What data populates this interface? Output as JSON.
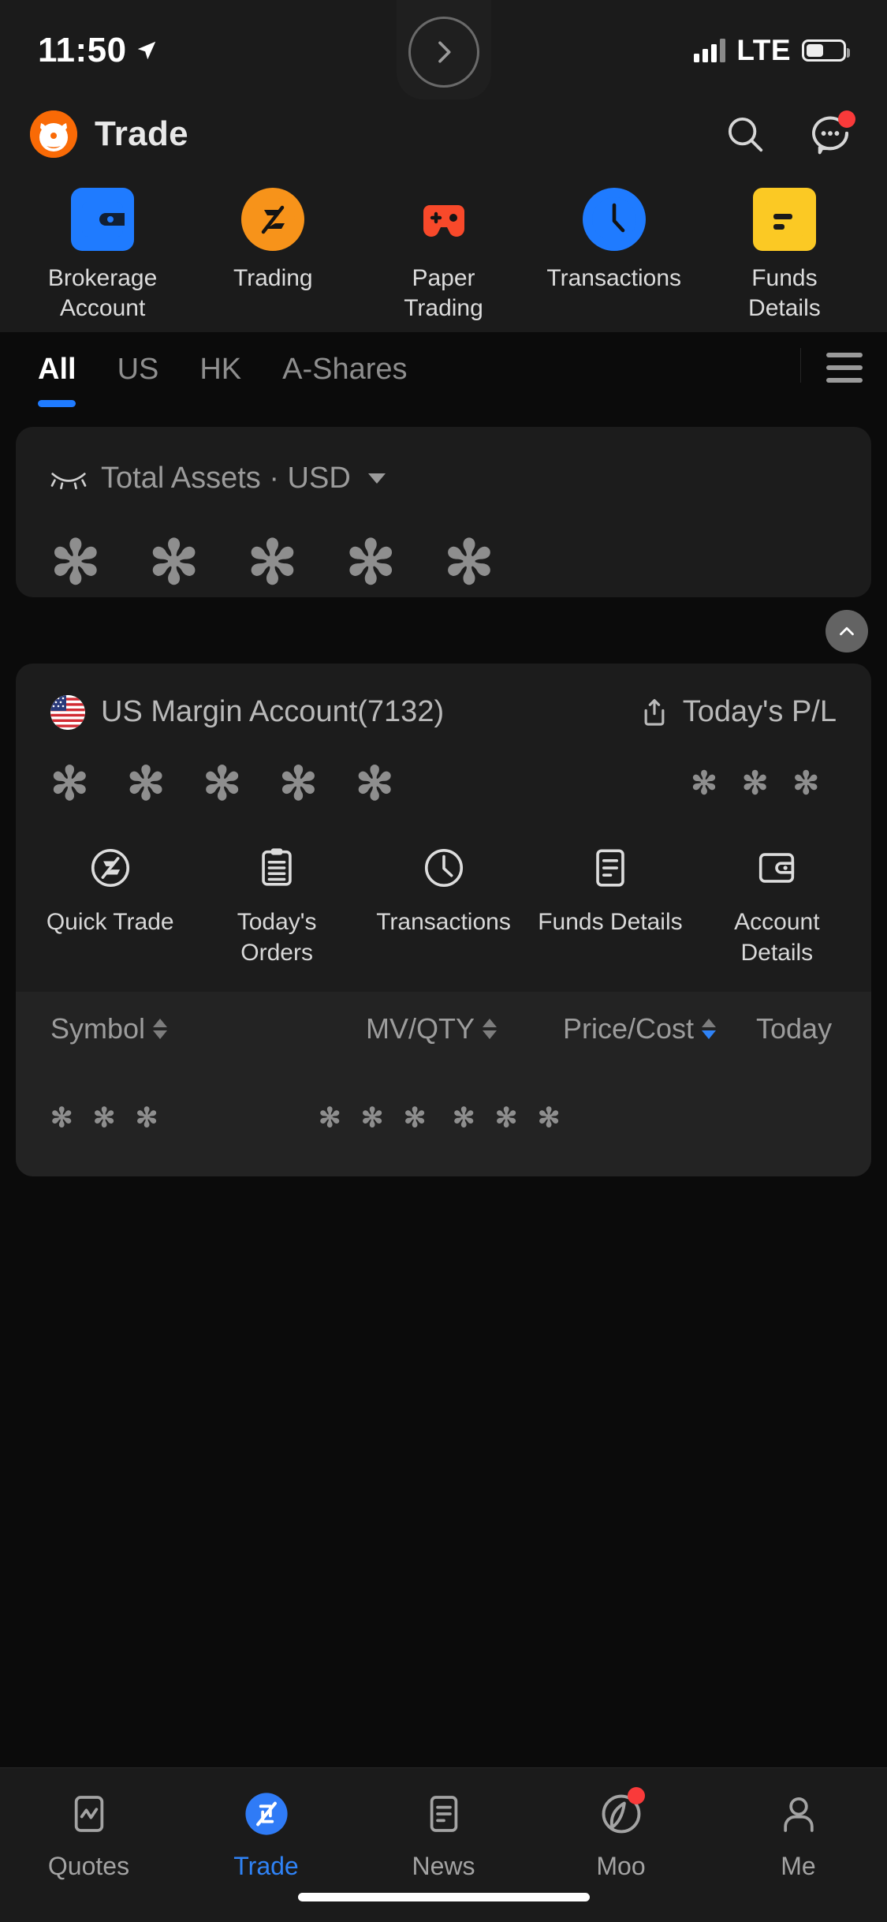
{
  "status_bar": {
    "time": "11:50",
    "location_icon": "location-arrow-icon",
    "carrier": "LTE",
    "signal_icon": "signal-bars-icon",
    "battery_icon": "battery-icon",
    "notch_button_icon": "chevron-right-circle-icon"
  },
  "header": {
    "logo_icon": "moomoo-bull-logo",
    "title": "Trade",
    "search_icon": "search-icon",
    "messages_icon": "message-dots-icon",
    "messages_has_badge": true
  },
  "quick_actions": [
    {
      "label": "Brokerage Account",
      "icon": "wallet-icon",
      "color": "#1f7bff"
    },
    {
      "label": "Trading",
      "icon": "trading-z-icon",
      "color": "#f7931a"
    },
    {
      "label": "Paper Trading",
      "icon": "gamepad-icon",
      "color": "#f8492a"
    },
    {
      "label": "Transactions",
      "icon": "clock-icon",
      "color": "#1f7bff"
    },
    {
      "label": "Funds Details",
      "icon": "document-icon",
      "color": "#fbc924"
    }
  ],
  "filter_tabs": {
    "items": [
      {
        "label": "All",
        "active": true
      },
      {
        "label": "US",
        "active": false
      },
      {
        "label": "HK",
        "active": false
      },
      {
        "label": "A-Shares",
        "active": false
      }
    ],
    "menu_icon": "hamburger-menu-icon",
    "active_color": "#1f7bff"
  },
  "total_assets": {
    "eye_icon": "eye-closed-icon",
    "label": "Total Assets · USD",
    "currency_caret_icon": "chevron-down-icon",
    "value_masked": "✻ ✻ ✻ ✻ ✻"
  },
  "collapse_button": {
    "icon": "chevron-up-icon"
  },
  "account": {
    "flag_icon": "us-flag-icon",
    "name": "US Margin Account(7132)",
    "pl_share_icon": "share-export-icon",
    "pl_label": "Today's P/L",
    "balance_masked": "✻ ✻ ✻ ✻ ✻",
    "pl_masked": "✻ ✻ ✻",
    "actions": [
      {
        "label": "Quick Trade",
        "icon": "quick-trade-icon"
      },
      {
        "label": "Today's Orders",
        "icon": "clipboard-orders-icon"
      },
      {
        "label": "Transactions",
        "icon": "clock-icon"
      },
      {
        "label": "Funds Details",
        "icon": "document-lines-icon"
      },
      {
        "label": "Account Details",
        "icon": "wallet-outline-icon"
      }
    ]
  },
  "positions_table": {
    "columns": [
      {
        "label": "Symbol",
        "sortable": true,
        "sort_state": "none"
      },
      {
        "label": "MV/QTY",
        "sortable": true,
        "sort_state": "none"
      },
      {
        "label": "Price/Cost",
        "sortable": true,
        "sort_state": "desc"
      },
      {
        "label": "Today",
        "sortable": false,
        "sort_state": "none"
      }
    ],
    "rows": [
      {
        "symbol": "✻ ✻ ✻",
        "mv_qty": "✻ ✻ ✻",
        "price_cost": "✻ ✻ ✻"
      }
    ],
    "active_sort_color": "#2f83f7"
  },
  "bottom_nav": {
    "items": [
      {
        "label": "Quotes",
        "icon": "chart-quotes-icon",
        "active": false,
        "badge": false
      },
      {
        "label": "Trade",
        "icon": "trade-arrows-icon",
        "active": true,
        "badge": false
      },
      {
        "label": "News",
        "icon": "news-doc-icon",
        "active": false,
        "badge": false
      },
      {
        "label": "Moo",
        "icon": "moo-community-icon",
        "active": false,
        "badge": true
      },
      {
        "label": "Me",
        "icon": "person-icon",
        "active": false,
        "badge": false
      }
    ],
    "active_color": "#2f83f7"
  }
}
